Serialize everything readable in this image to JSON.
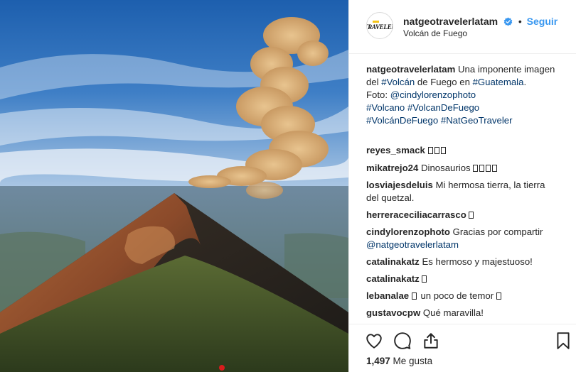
{
  "post": {
    "username": "natgeotravelerlatam",
    "follow_label": "Seguir",
    "separator": "•",
    "location": "Volcán de Fuego",
    "avatar_text": "TRAVELER",
    "caption": {
      "username": "natgeotravelerlatam",
      "text1": " Una imponente imagen del ",
      "tag1": "#Volcán",
      "text2": " de Fuego en ",
      "tag2": "#Guatemala",
      "text3": ".",
      "foto_label": "Foto: ",
      "mention": "@cindylorenzophoto",
      "tag3": "#Volcano",
      "tag4": "#VolcanDeFuego",
      "tag5": "#VolcánDeFuego",
      "tag6": "#NatGeoTraveler"
    },
    "likes_count": "1,497",
    "likes_label": " Me gusta"
  },
  "comments": [
    {
      "user": "reyes_smack",
      "text": "",
      "boxes": 3
    },
    {
      "user": "mikatrejo24",
      "text": "Dinosaurios",
      "boxes": 4
    },
    {
      "user": "losviajesdeluis",
      "text": "Mi hermosa tierra, la tierra del quetzal."
    },
    {
      "user": "herreraceciliacarrasco",
      "text": "",
      "boxes": 1
    },
    {
      "user": "cindylorenzophoto",
      "text": "Gracias por compartir",
      "mention": "@natgeotravelerlatam"
    },
    {
      "user": "catalinakatz",
      "text": "Es hermoso y majestuoso!"
    },
    {
      "user": "catalinakatz",
      "text": "",
      "boxes": 1
    },
    {
      "user": "lebanalae",
      "text": "un poco de temor",
      "boxes_before": 1,
      "boxes_after": 1
    },
    {
      "user": "gustavocpw",
      "text": "Qué maravilla!"
    }
  ],
  "icons": {
    "like": "heart-icon",
    "comment": "comment-icon",
    "share": "share-icon",
    "save": "bookmark-icon",
    "verified": "verified-badge-icon"
  },
  "colors": {
    "link": "#3897f0",
    "hashtag": "#003569",
    "text": "#262626"
  }
}
